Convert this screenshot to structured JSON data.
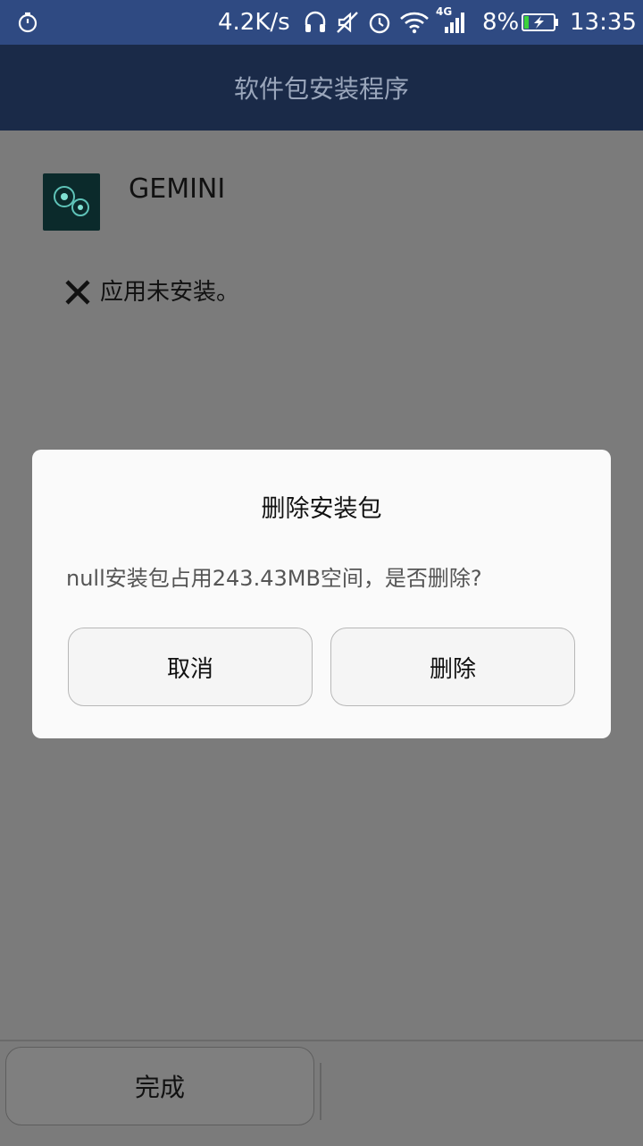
{
  "status_bar": {
    "net_speed": "4.2K/s",
    "network_type": "4G",
    "battery_percent": "8%",
    "time": "13:35",
    "icons": [
      "timer-icon",
      "headphones-icon",
      "mute-icon",
      "alarm-icon",
      "wifi-icon",
      "signal-icon",
      "battery-charging-icon"
    ]
  },
  "header": {
    "title": "软件包安装程序"
  },
  "app": {
    "name": "GEMINI",
    "status_text": "应用未安装。"
  },
  "dialog": {
    "title": "删除安装包",
    "message": "null安装包占用243.43MB空间，是否删除?",
    "cancel_label": "取消",
    "delete_label": "删除"
  },
  "footer": {
    "done_label": "完成"
  },
  "colors": {
    "status_bar_bg": "#2f4a82",
    "title_bar_bg": "#1a2a48",
    "dim_overlay": "#7b7b7b",
    "dialog_bg": "#fafafa"
  }
}
